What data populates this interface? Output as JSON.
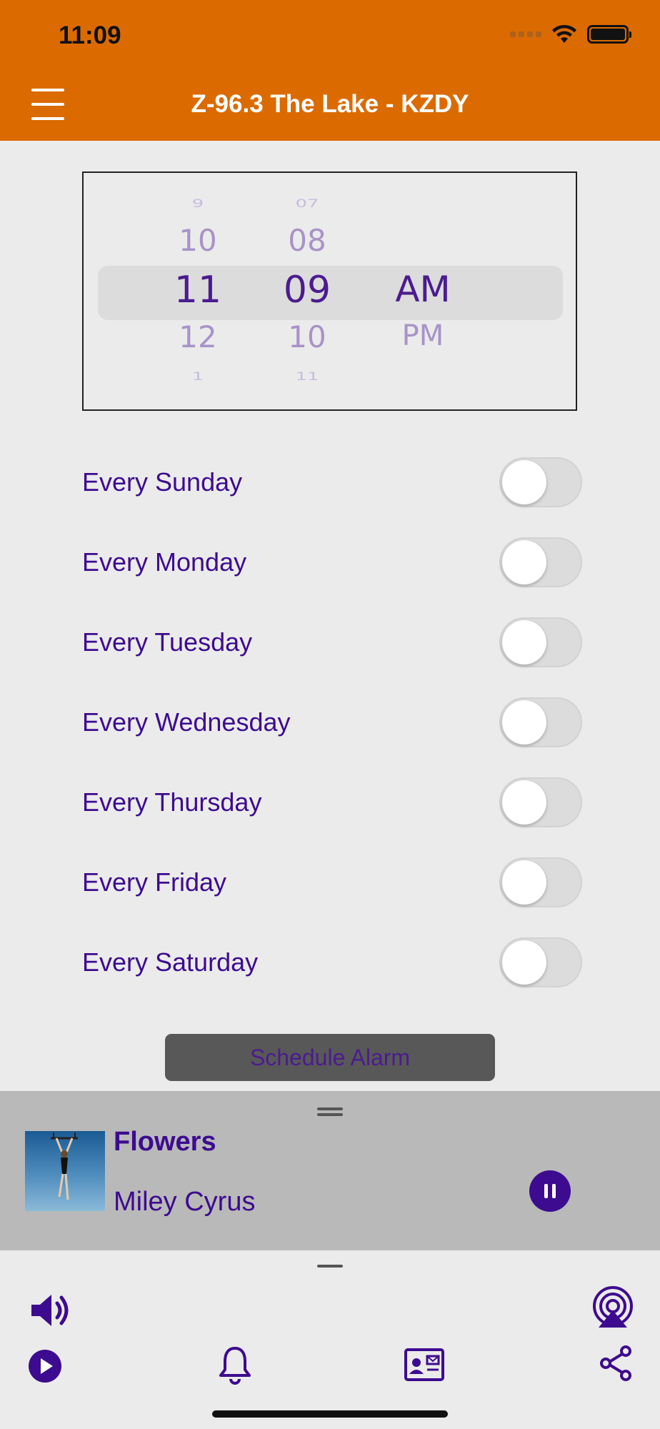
{
  "status_bar": {
    "time": "11:09"
  },
  "header": {
    "title": "Z-96.3 The Lake - KZDY"
  },
  "time_picker": {
    "hours": [
      "9",
      "10",
      "11",
      "12",
      "1"
    ],
    "minutes": [
      "07",
      "08",
      "09",
      "10",
      "11"
    ],
    "periods": [
      "AM",
      "PM"
    ],
    "selected": {
      "hour": "11",
      "minute": "09",
      "period": "AM"
    }
  },
  "days": [
    {
      "label": "Every Sunday",
      "on": false
    },
    {
      "label": "Every Monday",
      "on": false
    },
    {
      "label": "Every Tuesday",
      "on": false
    },
    {
      "label": "Every Wednesday",
      "on": false
    },
    {
      "label": "Every Thursday",
      "on": false
    },
    {
      "label": "Every Friday",
      "on": false
    },
    {
      "label": "Every Saturday",
      "on": false
    }
  ],
  "schedule_button": {
    "label": "Schedule Alarm"
  },
  "now_playing": {
    "title": "Flowers",
    "artist": "Miley Cyrus"
  },
  "colors": {
    "header": "#db6b00",
    "accent": "#3d0b8f",
    "background": "#ebebeb",
    "player": "#b9b9b9"
  },
  "icons": [
    "menu-icon",
    "wifi-icon",
    "battery-icon",
    "pause-icon",
    "volume-icon",
    "airplay-icon",
    "play-icon",
    "bell-icon",
    "contact-card-icon",
    "share-icon"
  ]
}
